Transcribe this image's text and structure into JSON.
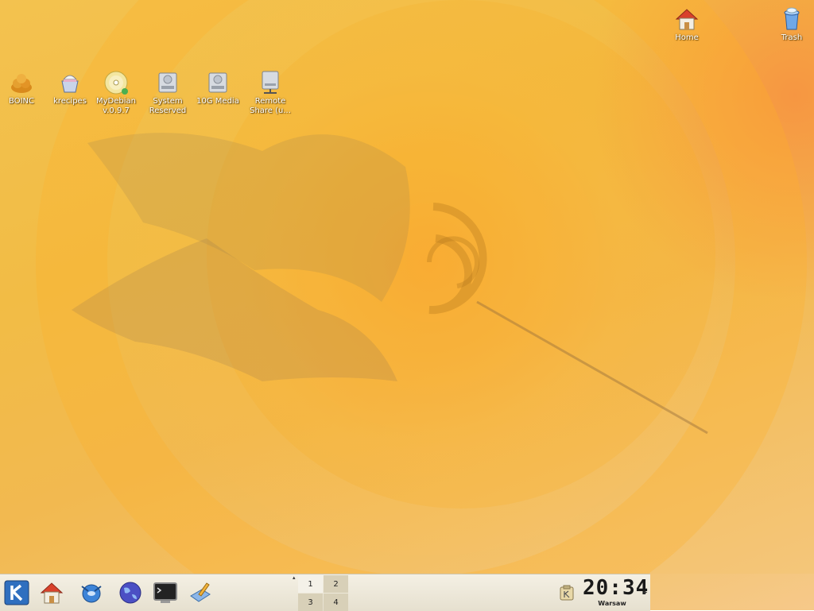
{
  "desktop": {
    "wallpaper": "debian-swirl-orange",
    "icons": [
      {
        "id": "boinc",
        "label": "BOINC",
        "icon": "boinc-icon"
      },
      {
        "id": "krecipes",
        "label": "krecipes",
        "icon": "krecipes-icon"
      },
      {
        "id": "mydebian",
        "label": "MyDebian v.0.9.7",
        "icon": "cdrom-icon"
      },
      {
        "id": "system-reserved",
        "label": "System Reserved",
        "icon": "harddisk-icon"
      },
      {
        "id": "10g-media",
        "label": "10G Media",
        "icon": "harddisk-icon"
      },
      {
        "id": "remote-share",
        "label": "Remote Share (u...",
        "icon": "network-drive-icon"
      },
      {
        "id": "home",
        "label": "Home",
        "icon": "home-icon"
      },
      {
        "id": "trash",
        "label": "Trash",
        "icon": "trash-icon"
      }
    ]
  },
  "panel": {
    "launchers": [
      {
        "id": "kmenu",
        "icon": "k-menu-icon"
      },
      {
        "id": "home",
        "icon": "home-icon"
      },
      {
        "id": "konqueror",
        "icon": "konqueror-icon"
      },
      {
        "id": "browser",
        "icon": "globe-icon"
      },
      {
        "id": "terminal",
        "icon": "terminal-icon"
      },
      {
        "id": "editor",
        "icon": "kwrite-icon"
      }
    ],
    "pager": {
      "desktops": [
        "1",
        "2",
        "3",
        "4"
      ],
      "active": "1"
    },
    "systray": [
      {
        "id": "klipper",
        "icon": "klipper-icon"
      }
    ],
    "clock": {
      "time": "20:34",
      "zone": "Warsaw"
    },
    "colors": {
      "panel_bg": "#efeadb",
      "pager_active": "#f4f1e8",
      "pager_inactive": "#d8d0b8"
    }
  }
}
